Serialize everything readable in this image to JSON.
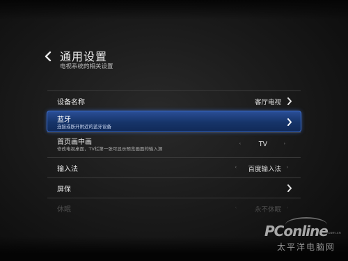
{
  "header": {
    "back_icon": "chevron-left-icon",
    "title": "通用设置",
    "subtitle": "电视系统的相关设置"
  },
  "settings": [
    {
      "label": "设备名称",
      "value": "客厅电视",
      "chevron": "chevron-right-icon"
    },
    {
      "label": "蓝牙",
      "sub": "连接或断开附近的蓝牙设备",
      "chevron": "chevron-right-icon",
      "selected": true
    },
    {
      "label": "首页画中画",
      "sub": "修改电视桌面，TV栏第一张可显示预览画面的输入源",
      "value": "TV",
      "left_arrow": "‹",
      "right_arrow": "›"
    },
    {
      "label": "输入法",
      "value": "百度输入法",
      "left_arrow": "‹",
      "right_arrow": "›"
    },
    {
      "label": "屏保",
      "chevron": "chevron-right-icon"
    },
    {
      "label": "休眠",
      "value": "永不休眠",
      "left_arrow": "‹",
      "right_arrow": "›"
    }
  ],
  "watermark": {
    "logo": "PConline",
    "domain": ".com.cn",
    "name": "太平洋电脑网"
  },
  "colors": {
    "selected_bg": "#1a3a78",
    "selected_border": "#3d6fd0",
    "background": "#1b1b1b"
  }
}
